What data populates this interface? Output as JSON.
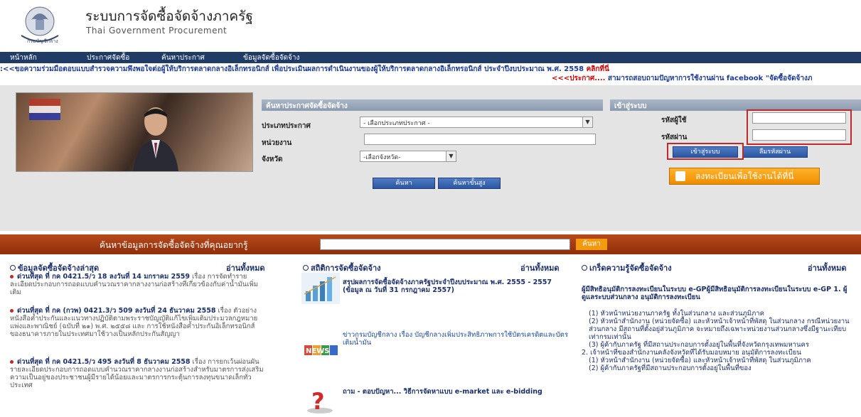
{
  "header": {
    "title": "ระบบการจัดซื้อจัดจ้างภาครัฐ",
    "subtitle": "Thai Government Procurement"
  },
  "nav": {
    "items": [
      "หน้าหลัก",
      "ประกาศจัดซื้อ",
      "ค้นหาประกาศ",
      "ข้อมูลจัดซื้อจัดจ้าง"
    ]
  },
  "marquee": {
    "line1_text": ":<<ขอความร่วมมือตอบแบบสำรวจความพึงพอใจต่อผู้ให้บริการตลาดกลางอิเล็กทรอนิกส์ เพื่อประเมินผลการดำเนินงานของผู้ให้บริการตลาดกลางอิเล็กทรอนิกส์ ประจำปีงบประมาณ พ.ศ. 2558",
    "line1_link": "คลิกที่นี่",
    "line2_prefix": "<<<ประกาศ....",
    "line2_text": " สามารถสอบถามปัญหาการใช้งานผ่าน facebook \"จัดซื้อจัดจ้างภ"
  },
  "search": {
    "title": "ค้นหาประกาศจัดซื้อจัดจ้าง",
    "type_label": "ประเภทประกาศ",
    "type_value": "- เลือกประเภทประกาศ -",
    "agency_label": "หน่วยงาน",
    "agency_value": "",
    "province_label": "จังหวัด",
    "province_value": "-เลือกจังหวัด-",
    "search_button": "ค้นหา",
    "advanced_button": "ค้นหาขั้นสูง"
  },
  "login": {
    "title": "เข้าสู่ระบบ",
    "user_label": "รหัสผู้ใช้",
    "pass_label": "รหัสผ่าน",
    "login_button": "เข้าสู่ระบบ",
    "forgot_button": "ลืมรหัสผ่าน",
    "register_button": "ลงทะเบียนเพื่อใช้งานได้ที่นี่"
  },
  "quick_search": {
    "label": "ค้นหาข้อมูลการจัดซื้อจัดจ้างที่คุณอยากรู้",
    "button": "ค้นหา"
  },
  "columns": {
    "latest": {
      "title": "ข้อมูลจัดซื้อจัดจ้างล่าสุด",
      "read_all": "อ่านทั้งหมด",
      "items": [
        {
          "lead": "ด่วนที่สุด ที่ กค 0421.5/ว 18 ลงวันที่ 14 มกราคม 2559",
          "text": " เรื่อง การจัดทำรายละเอียดประกอบการถอดแบบคำนวณราคากลางงานก่อสร้างที่เกี่ยวข้องกับค่าน้ำมันเพิ่มเติม"
        },
        {
          "lead": "ด่วนที่สุด ที่ กค (กวพ) 0421.3/ว 509 ลงวันที่ 24 ธันวาคม 2558",
          "text": " เรื่อง ตัวอย่างหนังสือค้ำประกันและแนวทางปฏิบัติตามพระราชบัญญัติแก้ไขเพิ่มเติมประมวลกฎหมายแพ่งและพาณิชย์ (ฉบับที่ ๒๑) พ.ศ. ๒๕๕๘ และ การใช้หนังสือค้ำประกันอิเล็กทรอนิกส์ของธนาคารภายในประเทศมาใช้วางเป็นหลักประกันสัญญา"
        },
        {
          "lead": "ด่วนที่สุด ที่ กค 0421.5/ว 495 ลงวันที่ 8 ธันวาคม 2558",
          "text": " เรื่อง การยกเว้นผ่อนผันรายละเอียดประกอบการถอดแบบคำนวณราคากลางงานก่อสร้างสำหรับมาตรการส่งเสริมความเป็นอยู่ของประชาชนผู้มีรายได้น้อยและมาตรการกระตุ้นการลงทุนขนาดเล็กทั่วประเทศ"
        }
      ]
    },
    "stats": {
      "title": "สถิติการจัดซื้อจัดจ้าง",
      "read_all": "อ่านทั้งหมด",
      "items": [
        "สรุปผลการจัดซื้อจัดจ้างภาครัฐประจำปีงบประมาณ พ.ศ. 2555 - 2557 (ข้อมูล ณ วันที่ 31 กรกฎาคม 2557)",
        "ข่าวกรมบัญชีกลาง เรื่อง บัญชีกลางเพิ่มประสิทธิภาพการใช้บัตรเครดิตและบัตรเติมน้ำมัน",
        "ถาม - ตอบปัญหา... วิธีการจัดหาแบบ e-market และ e-bidding"
      ],
      "news_badge": "NEWS"
    },
    "knowledge": {
      "title": "เกร็ดความรู้จัดซื้อจัดจ้าง",
      "read_all": "อ่านทั้งหมด",
      "heading": "ผู้มีสิทธิอนุมัติการลงทะเบียนในระบบ e-GPผู้มีสิทธิอนุมัติการลงทะเบียนในระบบ e-GP   1. ผู้ดูแลระบบส่วนกลาง อนุมัติการลงทะเบียน",
      "lines": [
        "(1) หัวหน้าหน่วยงานภาครัฐ ทั้งในส่วนกลาง และส่วนภูมิภาค",
        "(2) หัวหน้าสำนักงาน (หน่วยจัดซื้อ) และหัวหน้าเจ้าหน้าที่พัสดุ ในส่วนกลาง กรณีหน่วยงานส่วนกลาง มีสถานที่ตั้งอยู่ส่วนภูมิภาค จะหมายถึงเฉพาะหน่วยงานส่วนกลางซึ่งมีฐานะเทียบเท่ากรมเท่านั้น",
        "(3) ผู้ค้ากับภาครัฐ ที่มีสถานประกอบการตั้งอยู่ในพื้นที่จังหวัดกรุงเทพมหานคร",
        "2. เจ้าหน้าที่ของสำนักงานคลังจังหวัดที่ได้รับมอบหมาย อนุมัติการลงทะเบียน",
        "(1) หัวหน้าสำนักงาน (หน่วยจัดซื้อ) และหัวหน้าเจ้าหน้าที่พัสดุ ในส่วนภูมิภาค",
        "(2) ผู้ค้ากับภาครัฐที่มีสถานประกอบการตั้งอยู่ในพื้นที่ของ"
      ]
    }
  }
}
